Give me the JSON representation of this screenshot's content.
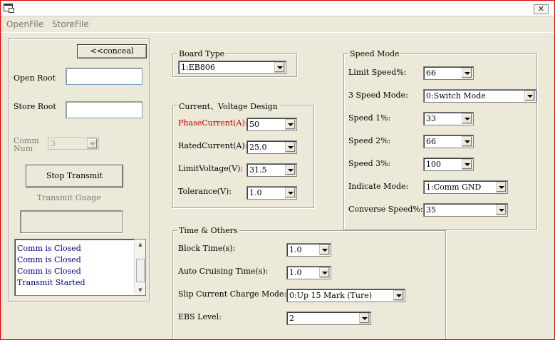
{
  "menu": {
    "open_file": "OpenFile",
    "store_file": "StoreFile"
  },
  "window": {
    "close_glyph": "✕"
  },
  "left": {
    "conceal_label": "<<conceal",
    "open_root_label": "Open Root",
    "open_root_value": "",
    "store_root_label": "Store Root",
    "store_root_value": "",
    "comm_num_label_1": "Comm",
    "comm_num_label_2": "Num",
    "comm_num_value": "3",
    "stop_transmit_label": "Stop Transmit",
    "transmit_gauge_label": "Transmit Guage",
    "transmit_progress": 0,
    "log": [
      "Comm is Closed",
      "Comm is Closed",
      "Comm is Closed",
      "Transmit Started"
    ]
  },
  "board_type": {
    "title": "Board Type",
    "value": "1:EB806"
  },
  "current_voltage": {
    "title": "Current、Voltage Design",
    "phase_current_label": "PhaseCurrent(A):",
    "phase_current_value": "50",
    "rated_current_label": "RatedCurrent(A):",
    "rated_current_value": "25.0",
    "limit_voltage_label": "LimitVoltage(V):",
    "limit_voltage_value": "31.5",
    "tolerance_label": "Tolerance(V):",
    "tolerance_value": "1.0"
  },
  "speed_mode": {
    "title": "Speed Mode",
    "limit_speed_label": "Limit Speed%:",
    "limit_speed_value": "66",
    "three_speed_mode_label": "3 Speed Mode:",
    "three_speed_mode_value": "0:Switch Mode",
    "speed1_label": "Speed 1%:",
    "speed1_value": "33",
    "speed2_label": "Speed 2%:",
    "speed2_value": "66",
    "speed3_label": "Speed 3%:",
    "speed3_value": "100",
    "indicate_mode_label": "Indicate Mode:",
    "indicate_mode_value": "1:Comm GND",
    "converse_speed_label": "Converse Speed%:",
    "converse_speed_value": "35"
  },
  "time_others": {
    "title": "Time & Others",
    "block_time_label": "Block Time(s):",
    "block_time_value": "1.0",
    "auto_cruising_label": "Auto Cruising Time(s):",
    "auto_cruising_value": "1.0",
    "slip_current_label": "Slip Current Charge Mode:",
    "slip_current_value": "0:Up 15 Mark (Ture)",
    "ebs_level_label": "EBS Level:",
    "ebs_level_value": "2"
  },
  "colors": {
    "window_bg": "#ece9d8",
    "window_border": "#d40000",
    "log_text": "#00007a",
    "highlight_label": "#c00000"
  }
}
